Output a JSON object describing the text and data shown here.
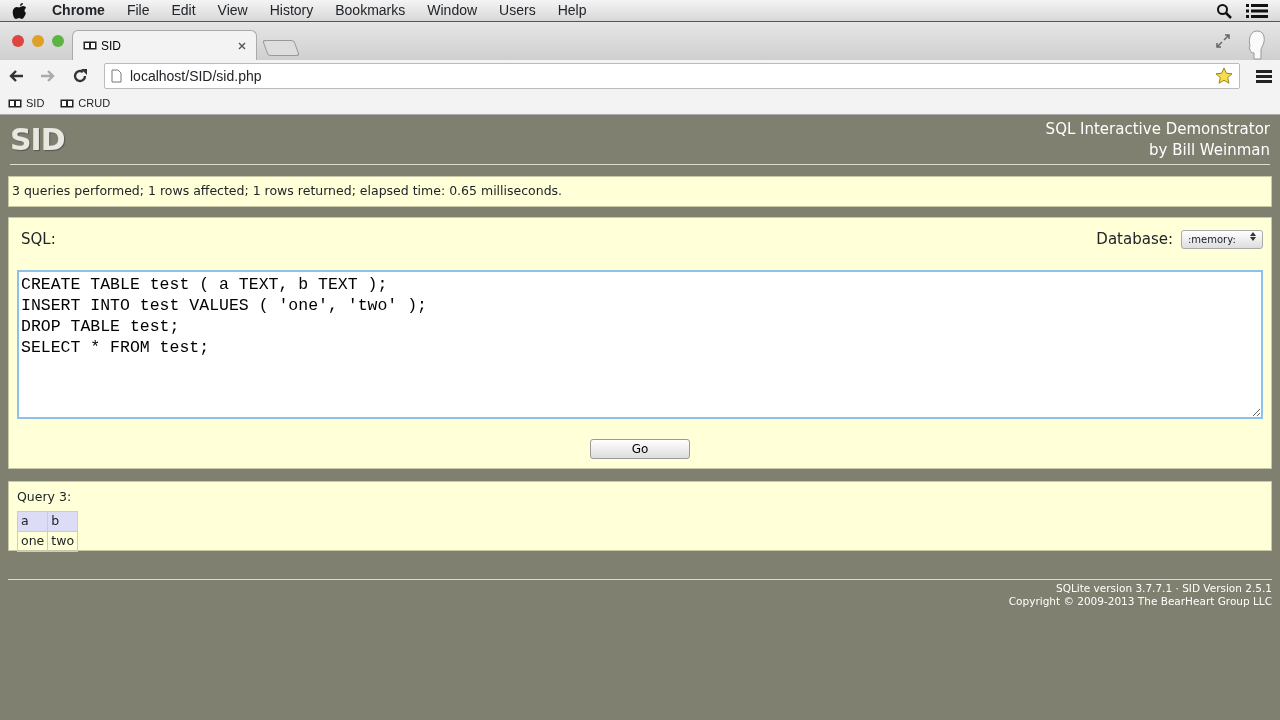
{
  "menubar": {
    "app": "Chrome",
    "items": [
      "File",
      "Edit",
      "View",
      "History",
      "Bookmarks",
      "Window",
      "Users",
      "Help"
    ]
  },
  "tabs": [
    {
      "title": "SID",
      "selected": true
    }
  ],
  "address_bar": {
    "url": "localhost/SID/sid.php"
  },
  "bookmarks": [
    "SID",
    "CRUD"
  ],
  "page": {
    "logo": "SID",
    "title_lines": [
      "SQL Interactive Demonstrator",
      "by Bill Weinman"
    ],
    "status": "3 queries performed; 1 rows affected; 1 rows returned; elapsed time: 0.65 milliseconds.",
    "sql_label": "SQL:",
    "database_label": "Database:",
    "database_value": ":memory:",
    "sql": "CREATE TABLE test ( a TEXT, b TEXT );\nINSERT INTO test VALUES ( 'one', 'two' );\nDROP TABLE test;\nSELECT * FROM test;",
    "go_button": "Go",
    "result": {
      "caption": "Query 3:",
      "columns": [
        "a",
        "b"
      ],
      "rows": [
        [
          "one",
          "two"
        ]
      ]
    },
    "footer": [
      "SQLite version 3.7.7.1 · SID Version 2.5.1",
      "Copyright © 2009-2013 The BearHeart Group LLC"
    ]
  }
}
